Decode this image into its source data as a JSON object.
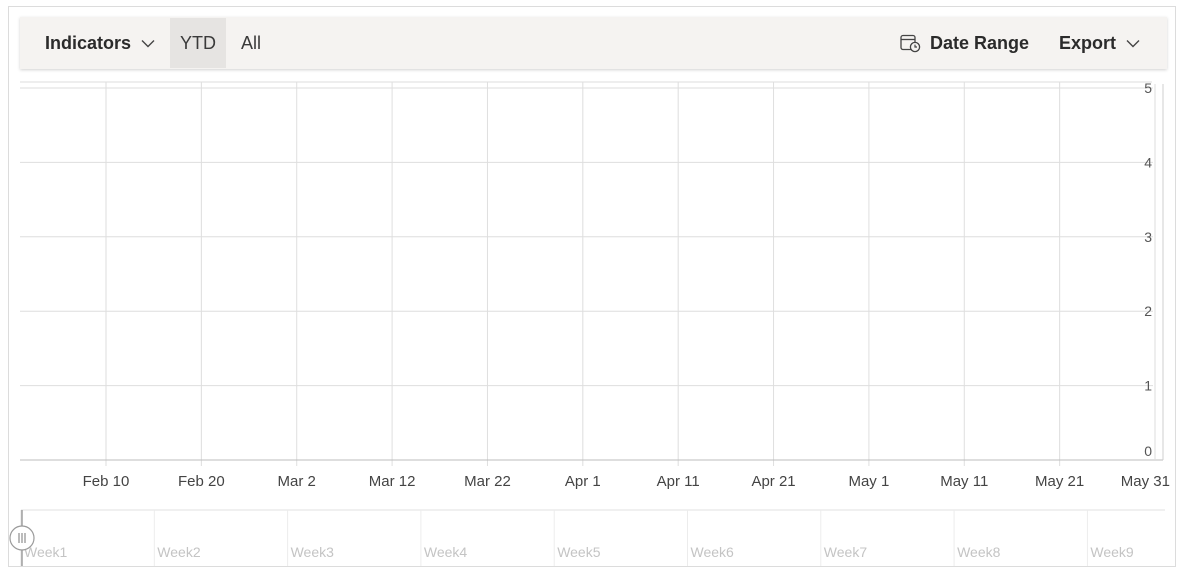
{
  "toolbar": {
    "indicators_label": "Indicators",
    "ytd_label": "YTD",
    "all_label": "All",
    "date_range_label": "Date Range",
    "export_label": "Export"
  },
  "chart_data": {
    "type": "line",
    "title": "",
    "xlabel": "",
    "ylabel": "",
    "x_ticks": [
      "Feb 10",
      "Feb 20",
      "Mar 2",
      "Mar 12",
      "Mar 22",
      "Apr 1",
      "Apr 11",
      "Apr 21",
      "May 1",
      "May 11",
      "May 21",
      "May 31"
    ],
    "xlim": [
      "2023-02-01",
      "2023-05-31"
    ],
    "y_ticks": [
      0,
      1,
      2,
      3,
      4,
      5
    ],
    "ylim": [
      0,
      5
    ],
    "y_axis_side": "right",
    "grid": true,
    "series": [],
    "navigator": {
      "labels": [
        "Week1",
        "Week2",
        "Week3",
        "Week4",
        "Week5",
        "Week6",
        "Week7",
        "Week8",
        "Week9"
      ],
      "selection_start": 0
    }
  }
}
